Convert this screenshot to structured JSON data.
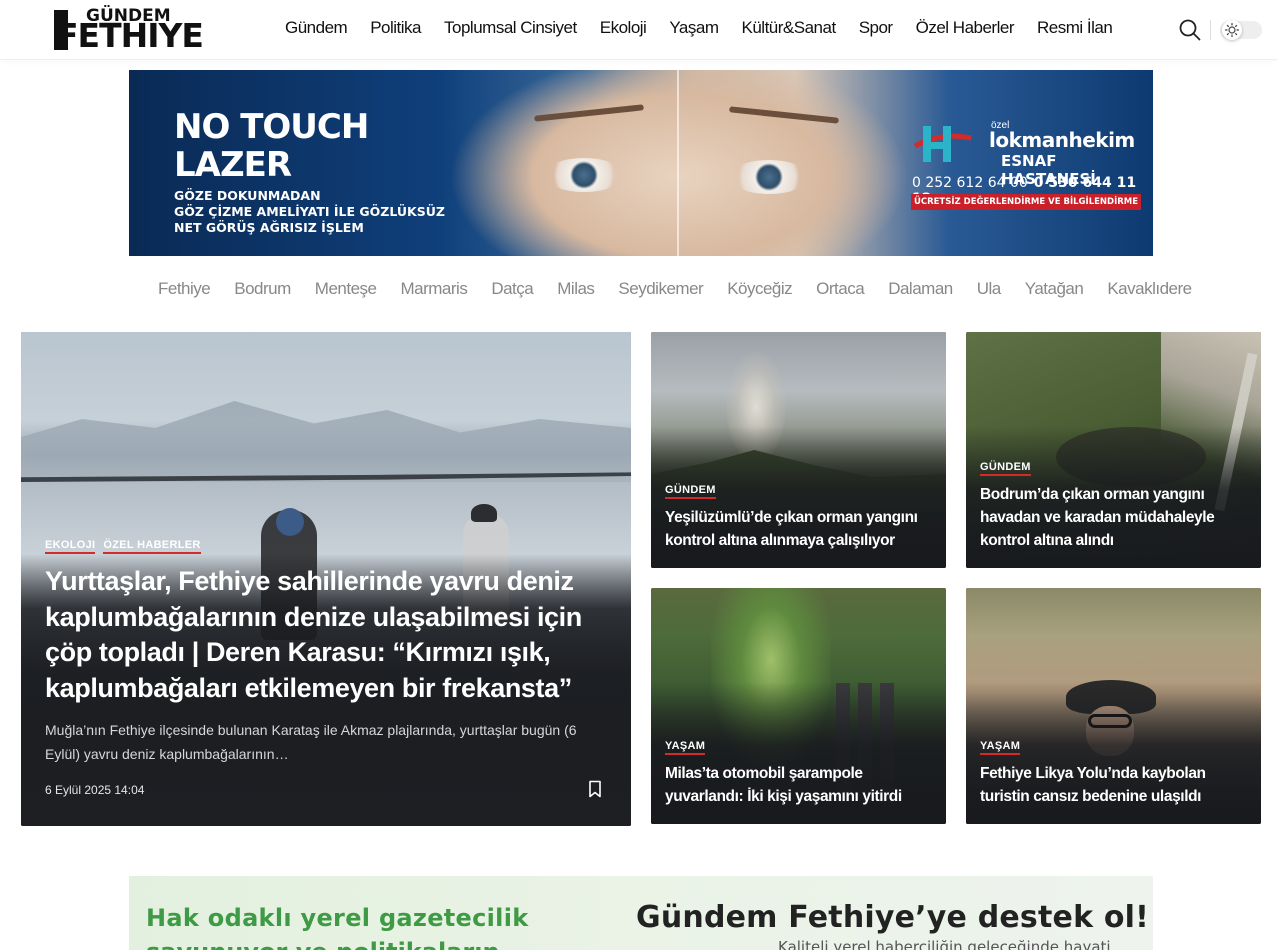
{
  "header": {
    "logo_top": "GÜNDEM",
    "logo_main": "FETHIYE",
    "nav": [
      "Gündem",
      "Politika",
      "Toplumsal Cinsiyet",
      "Ekoloji",
      "Yaşam",
      "Kültür&Sanat",
      "Spor",
      "Özel Haberler",
      "Resmi İlan"
    ],
    "search_icon": "search-icon",
    "mode_icon": "sun-icon"
  },
  "ad_banner": {
    "headline_1": "NO TOUCH",
    "headline_2": "LAZER",
    "sub_1": "GÖZE DOKUNMADAN",
    "sub_2": "GÖZ ÇİZME AMELİYATI İLE GÖZLÜKSÜZ",
    "sub_3": "NET GÖRÜŞ AĞRISIZ İŞLEM",
    "hospital_prefix": "özel",
    "hospital_name": "lokmanhekim",
    "hospital_sub": "ESNAF HASTANESİ",
    "phone_1": "0 252 612 64 00",
    "phone_2": "0 530 644 11 12",
    "notice": "ÜCRETSİZ DEĞERLENDİRME VE BİLGİLENDİRME"
  },
  "city_nav": [
    "Fethiye",
    "Bodrum",
    "Menteşe",
    "Marmaris",
    "Datça",
    "Milas",
    "Seydikemer",
    "Köyceğiz",
    "Ortaca",
    "Dalaman",
    "Ula",
    "Yatağan",
    "Kavaklıdere"
  ],
  "main_story": {
    "categories": [
      "EKOLOJI",
      "ÖZEL HABERLER"
    ],
    "title": "Yurttaşlar, Fethiye sahillerinde yavru deniz kaplumbağalarının denize ulaşabilmesi için çöp topladı | Deren Karasu: “Kırmızı ışık, kaplumbağaları etkilemeyen bir frekansta”",
    "excerpt": "Muğla’nın Fethiye ilçesinde bulunan Karataş ile Akmaz plajlarında, yurttaşlar bugün (6 Eylül) yavru deniz kaplumbağalarının…",
    "date": "6 Eylül 2025 14:04"
  },
  "side_stories": [
    {
      "category": "GÜNDEM",
      "title": "Yeşilüzümlü’de çıkan orman yangını kontrol altına alınmaya çalışılıyor"
    },
    {
      "category": "GÜNDEM",
      "title": "Bodrum’da çıkan orman yangını havadan ve karadan müdahaleyle kontrol altına alındı"
    },
    {
      "category": "YAŞAM",
      "title": "Milas’ta otomobil şarampole yuvarlandı: İki kişi yaşamını yitirdi"
    },
    {
      "category": "YAŞAM",
      "title": "Fethiye Likya Yolu’nda kaybolan turistin cansız bedenine ulaşıldı"
    }
  ],
  "support_banner": {
    "left_line": "Hak odaklı yerel gazetecilik",
    "left_line_2": "savunuyor ve politikaların",
    "title": "Gündem Fethiye’ye destek ol!",
    "subtitle": "Kaliteli yerel haberciliğin geleceğinde hayati"
  },
  "colors": {
    "accent_red": "#d42a2a",
    "support_green": "#3f9a45",
    "card_dark": "#1d1f23"
  }
}
